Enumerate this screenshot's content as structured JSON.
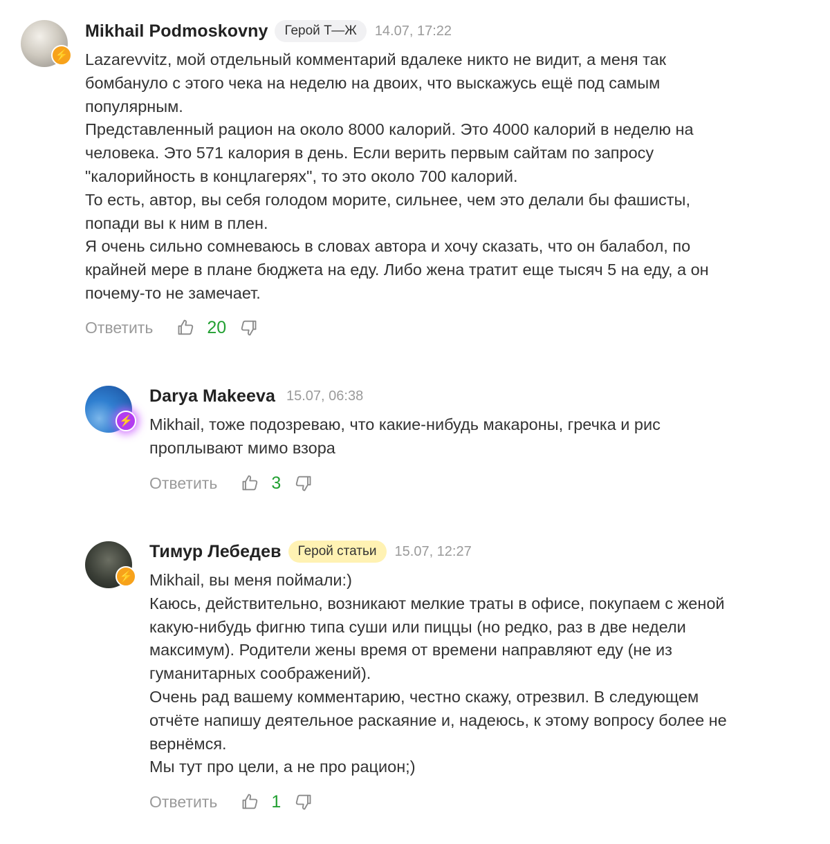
{
  "comments": [
    {
      "author": "Mikhail Podmoskovny",
      "badge": "Герой Т—Ж",
      "date": "14.07, 17:22",
      "lines": [
        "Lazarevvitz, мой отдельный комментарий вдалеке никто не видит, а меня так",
        "бомбануло с этого чека на неделю на двоих, что выскажусь ещё под самым",
        "популярным.",
        "Представленный рацион на около 8000 калорий. Это 4000 калорий в неделю на",
        "человека. Это 571 калория в день. Если верить первым сайтам по запросу",
        "\"калорийность в концлагерях\", то это около 700 калорий.",
        "То есть, автор, вы себя голодом морите, сильнее, чем это делали бы фашисты,",
        "попади вы к ним в плен.",
        "Я очень сильно сомневаюсь в словах автора и хочу сказать, что он балабол, по",
        "крайней мере в плане бюджета на еду. Либо жена тратит еще тысяч 5 на еду, а он",
        "почему-то не замечает."
      ],
      "reply_label": "Ответить",
      "likes": "20",
      "like_icon": "thumbs-up-icon",
      "dislike_icon": "thumbs-down-icon",
      "avatar_icon": "lightning-badge-icon"
    },
    {
      "author": "Darya Makeeva",
      "date": "15.07, 06:38",
      "lines": [
        "Mikhail, тоже подозреваю, что какие-нибудь макароны, гречка и рис",
        "проплывают мимо взора"
      ],
      "reply_label": "Ответить",
      "likes": "3",
      "like_icon": "thumbs-up-icon",
      "dislike_icon": "thumbs-down-icon",
      "avatar_icon": "lightning-badge-icon"
    },
    {
      "author": "Тимур Лебедев",
      "badge": "Герой статьи",
      "date": "15.07, 12:27",
      "lines": [
        "Mikhail, вы меня поймали:)",
        "Каюсь, действительно, возникают мелкие траты в офисе, покупаем с женой",
        "какую-нибудь фигню типа суши или пиццы (но редко, раз в две недели",
        "максимум). Родители жены время от времени направляют еду (не из",
        "гуманитарных соображений).",
        "Очень рад вашему комментарию, честно скажу, отрезвил. В следующем",
        "отчёте напишу деятельное раскаяние и, надеюсь, к этому вопросу более не",
        "вернёмся.",
        "Мы тут про цели, а не про рацион;)"
      ],
      "reply_label": "Ответить",
      "likes": "1",
      "like_icon": "thumbs-up-icon",
      "dislike_icon": "thumbs-down-icon",
      "avatar_icon": "lightning-badge-icon"
    }
  ],
  "colors": {
    "like_count": "#22a032",
    "badge_grey": "#f1f1f3",
    "badge_yellow": "#fff2b3",
    "bolt_orange": "#f7a21b",
    "bolt_purple": "#b23cf0"
  }
}
